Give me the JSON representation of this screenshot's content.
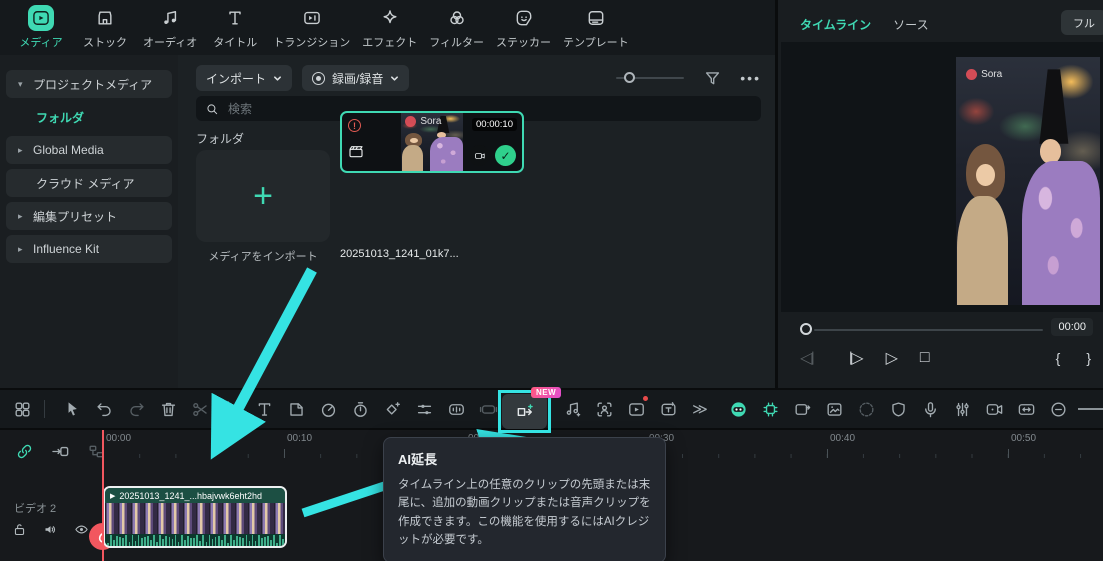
{
  "colors": {
    "accent": "#3fd9b3",
    "annotation_cyan": "#35e3e3",
    "playhead_red": "#f2575f",
    "badge_gradient_from": "#ff5a7e",
    "badge_gradient_to": "#e14dd0"
  },
  "top_nav": {
    "items": [
      {
        "label": "メディア",
        "active": true
      },
      {
        "label": "ストック",
        "active": false
      },
      {
        "label": "オーディオ",
        "active": false
      },
      {
        "label": "タイトル",
        "active": false
      },
      {
        "label": "トランジション",
        "active": false
      },
      {
        "label": "エフェクト",
        "active": false
      },
      {
        "label": "フィルター",
        "active": false
      },
      {
        "label": "ステッカー",
        "active": false
      },
      {
        "label": "テンプレート",
        "active": false
      }
    ]
  },
  "sidebar": {
    "items": [
      {
        "label": "プロジェクトメディア",
        "expanded": true
      },
      {
        "label": "フォルダ",
        "active": true
      },
      {
        "label": "Global Media"
      },
      {
        "label": "クラウド メディア"
      },
      {
        "label": "編集プリセット"
      },
      {
        "label": "Influence Kit"
      }
    ]
  },
  "media": {
    "import_button": "インポート",
    "record_button": "録画/録音",
    "search_placeholder": "検索",
    "section_title": "フォルダ",
    "import_card_label": "メディアをインポート",
    "clip_card_label": "20251013_1241_01k7...",
    "clip_duration": "00:00:10",
    "watermark": "Sora"
  },
  "preview": {
    "tab_timeline": "タイムライン",
    "tab_source": "ソース",
    "full_button": "フル",
    "current_time": "00:00",
    "watermark": "Sora"
  },
  "tooltip": {
    "badge": "NEW",
    "title": "AI延長",
    "body": "タイムライン上の任意のクリップの先頭または末尾に、追加の動画クリップまたは音声クリップを作成できます。この機能を使用するにはAIクレジットが必要です。"
  },
  "timeline": {
    "ruler": [
      "00:00",
      "00:10",
      "00:20",
      "00:30",
      "00:40",
      "00:50"
    ],
    "track_label": "ビデオ 2",
    "clip_label": "20251013_1241_...hbajvwk6eht2hd"
  }
}
